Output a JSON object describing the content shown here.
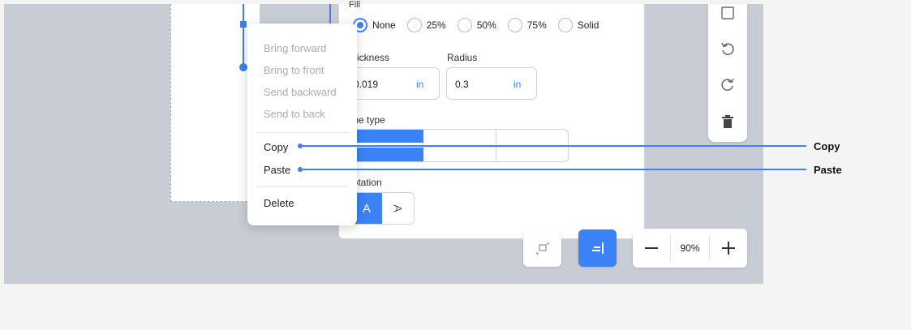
{
  "panel": {
    "fill_label": "Fill",
    "fill_options": [
      "None",
      "25%",
      "50%",
      "75%",
      "Solid"
    ],
    "fill_selected": "None",
    "thickness_label": "Thickness",
    "thickness_value": "0.019",
    "thickness_unit": "in",
    "radius_label": "Radius",
    "radius_value": "0.3",
    "radius_unit": "in",
    "line_type_label": "Line type",
    "rotation_label": "Rotation",
    "rotation_a_label": "A",
    "rotation_b_label": "A"
  },
  "context_menu": {
    "bring_forward": "Bring forward",
    "bring_to_front": "Bring to front",
    "send_backward": "Send backward",
    "send_to_back": "Send to back",
    "copy": "Copy",
    "paste": "Paste",
    "delete": "Delete"
  },
  "callouts": {
    "copy": "Copy",
    "paste": "Paste"
  },
  "toolbar": {
    "icons": [
      "square-icon",
      "undo-icon",
      "redo-icon",
      "trash-icon"
    ]
  },
  "bottom": {
    "zoom_value": "90%",
    "zoom_out_label": "—",
    "zoom_in_label": "+"
  },
  "colors": {
    "accent": "#3b82f6",
    "canvas": "#c8ccd5",
    "disabled_text": "#a9acb2"
  }
}
